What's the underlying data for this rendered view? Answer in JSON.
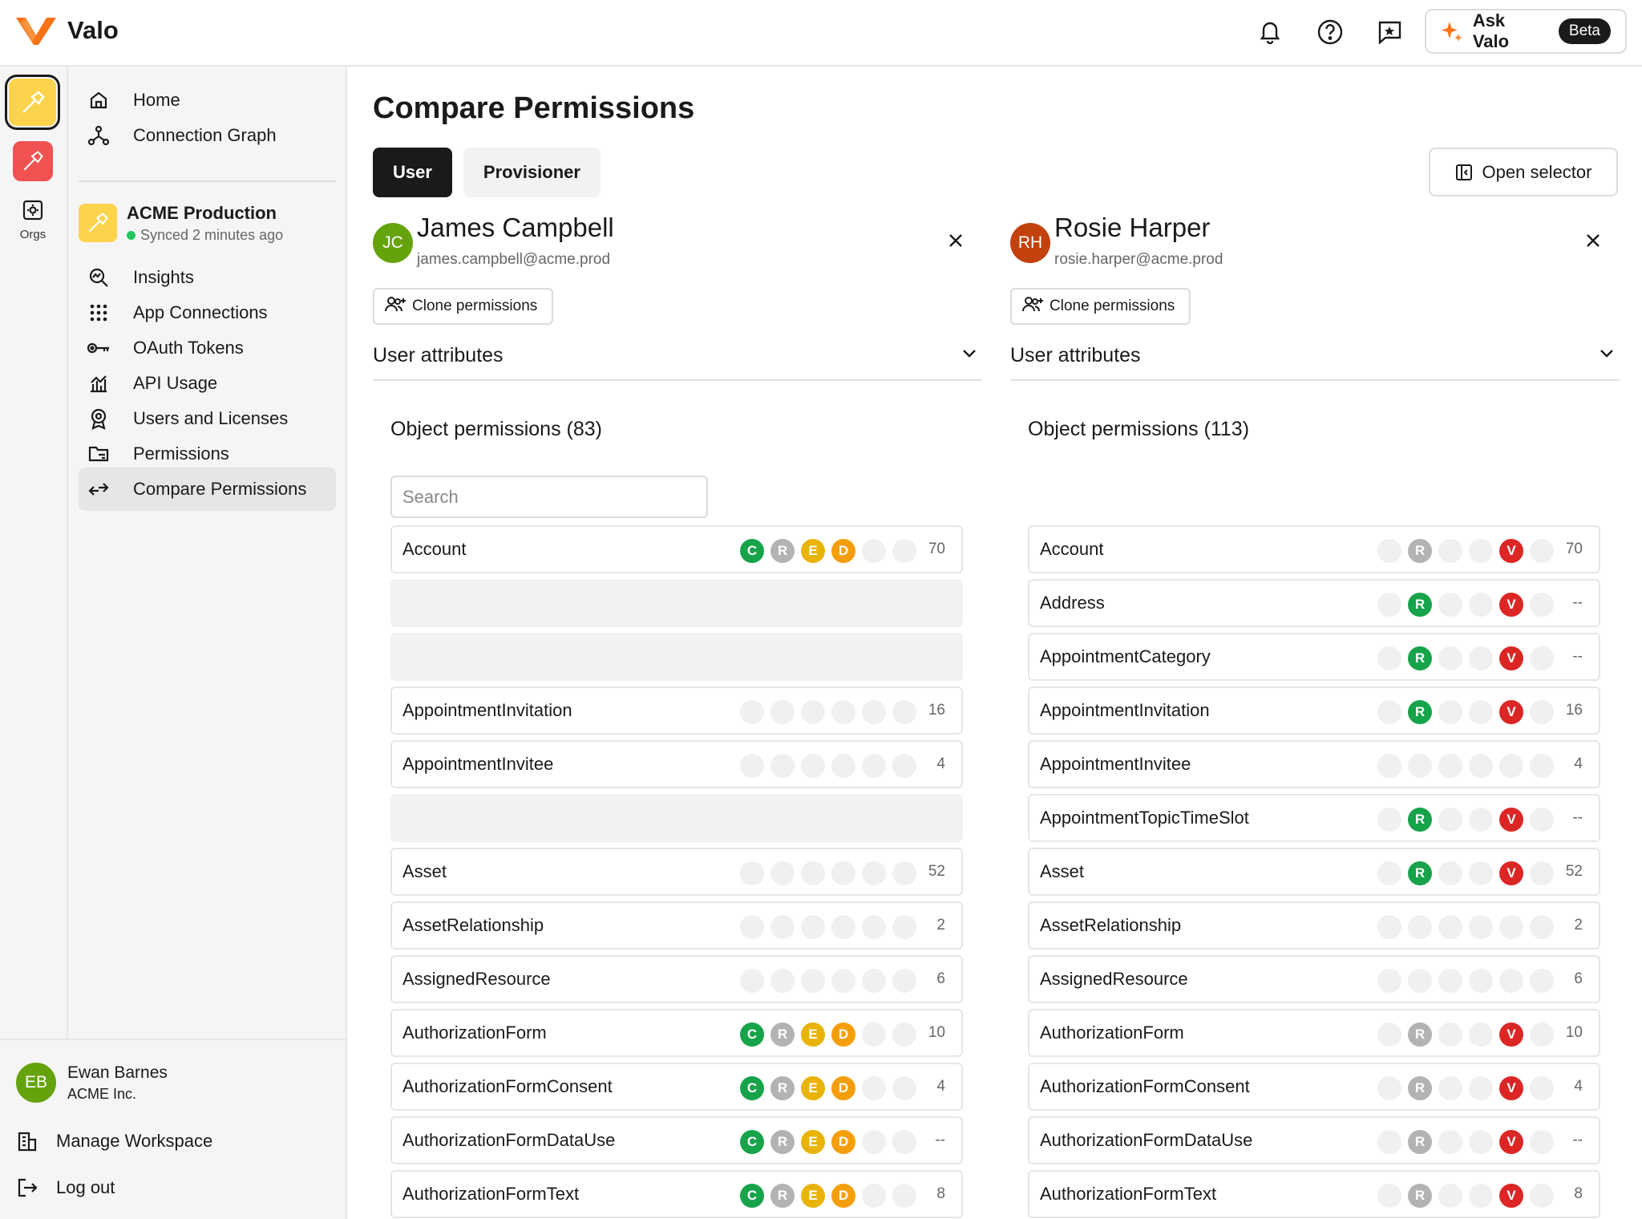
{
  "app": {
    "name": "Valo"
  },
  "header": {
    "ask_label": "Ask Valo",
    "beta": "Beta"
  },
  "rail": {
    "orgs_label": "Orgs"
  },
  "sidebar": {
    "nav_top": [
      {
        "label": "Home",
        "icon": "home-icon"
      },
      {
        "label": "Connection Graph",
        "icon": "graph-icon"
      }
    ],
    "org": {
      "name": "ACME Production",
      "sync": "Synced 2 minutes ago"
    },
    "nav_org": [
      {
        "label": "Insights",
        "icon": "insights-icon"
      },
      {
        "label": "App Connections",
        "icon": "grid-icon"
      },
      {
        "label": "OAuth Tokens",
        "icon": "key-icon"
      },
      {
        "label": "API Usage",
        "icon": "chart-icon"
      },
      {
        "label": "Users and Licenses",
        "icon": "badge-icon"
      },
      {
        "label": "Permissions",
        "icon": "folder-icon"
      },
      {
        "label": "Compare Permissions",
        "icon": "compare-icon",
        "active": true
      }
    ],
    "user": {
      "initials": "EB",
      "name": "Ewan Barnes",
      "org": "ACME Inc."
    },
    "manage_workspace": "Manage Workspace",
    "logout": "Log out"
  },
  "main": {
    "title": "Compare Permissions",
    "tabs": [
      "User",
      "Provisioner"
    ],
    "active_tab": "User",
    "open_selector": "Open selector"
  },
  "left": {
    "initials": "JC",
    "name": "James Campbell",
    "email": "james.campbell@acme.prod",
    "clone": "Clone permissions",
    "attributes": "User attributes",
    "obj_title": "Object permissions (83)",
    "search_placeholder": "Search",
    "rows": [
      {
        "name": "Account",
        "badges": [
          "C",
          "R",
          "E",
          "D",
          "",
          ""
        ],
        "count": "70"
      },
      {
        "skeleton": true
      },
      {
        "skeleton": true
      },
      {
        "name": "AppointmentInvitation",
        "badges": [
          "",
          "",
          "",
          "",
          "",
          ""
        ],
        "count": "16"
      },
      {
        "name": "AppointmentInvitee",
        "badges": [
          "",
          "",
          "",
          "",
          "",
          ""
        ],
        "count": "4"
      },
      {
        "skeleton": true
      },
      {
        "name": "Asset",
        "badges": [
          "",
          "",
          "",
          "",
          "",
          ""
        ],
        "count": "52"
      },
      {
        "name": "AssetRelationship",
        "badges": [
          "",
          "",
          "",
          "",
          "",
          ""
        ],
        "count": "2"
      },
      {
        "name": "AssignedResource",
        "badges": [
          "",
          "",
          "",
          "",
          "",
          ""
        ],
        "count": "6"
      },
      {
        "name": "AuthorizationForm",
        "badges": [
          "C",
          "R",
          "E",
          "D",
          "",
          ""
        ],
        "count": "10"
      },
      {
        "name": "AuthorizationFormConsent",
        "badges": [
          "C",
          "R",
          "E",
          "D",
          "",
          ""
        ],
        "count": "4"
      },
      {
        "name": "AuthorizationFormDataUse",
        "badges": [
          "C",
          "R",
          "E",
          "D",
          "",
          ""
        ],
        "count": "--"
      },
      {
        "name": "AuthorizationFormText",
        "badges": [
          "C",
          "R",
          "E",
          "D",
          "",
          ""
        ],
        "count": "8"
      }
    ]
  },
  "right": {
    "initials": "RH",
    "name": "Rosie Harper",
    "email": "rosie.harper@acme.prod",
    "clone": "Clone permissions",
    "attributes": "User attributes",
    "obj_title": "Object permissions (113)",
    "rows": [
      {
        "name": "Account",
        "badges": [
          "",
          "R",
          "",
          "",
          "V",
          ""
        ],
        "count": "70"
      },
      {
        "name": "Address",
        "badges": [
          "",
          "Rg",
          "",
          "",
          "V",
          ""
        ],
        "count": "--"
      },
      {
        "name": "AppointmentCategory",
        "badges": [
          "",
          "Rg",
          "",
          "",
          "V",
          ""
        ],
        "count": "--"
      },
      {
        "name": "AppointmentInvitation",
        "badges": [
          "",
          "Rg",
          "",
          "",
          "V",
          ""
        ],
        "count": "16"
      },
      {
        "name": "AppointmentInvitee",
        "badges": [
          "",
          "",
          "",
          "",
          "",
          ""
        ],
        "count": "4"
      },
      {
        "name": "AppointmentTopicTimeSlot",
        "badges": [
          "",
          "Rg",
          "",
          "",
          "V",
          ""
        ],
        "count": "--"
      },
      {
        "name": "Asset",
        "badges": [
          "",
          "Rg",
          "",
          "",
          "V",
          ""
        ],
        "count": "52"
      },
      {
        "name": "AssetRelationship",
        "badges": [
          "",
          "",
          "",
          "",
          "",
          ""
        ],
        "count": "2"
      },
      {
        "name": "AssignedResource",
        "badges": [
          "",
          "",
          "",
          "",
          "",
          ""
        ],
        "count": "6"
      },
      {
        "name": "AuthorizationForm",
        "badges": [
          "",
          "R",
          "",
          "",
          "V",
          ""
        ],
        "count": "10"
      },
      {
        "name": "AuthorizationFormConsent",
        "badges": [
          "",
          "R",
          "",
          "",
          "V",
          ""
        ],
        "count": "4"
      },
      {
        "name": "AuthorizationFormDataUse",
        "badges": [
          "",
          "R",
          "",
          "",
          "V",
          ""
        ],
        "count": "--"
      },
      {
        "name": "AuthorizationFormText",
        "badges": [
          "",
          "R",
          "",
          "",
          "V",
          ""
        ],
        "count": "8"
      }
    ]
  },
  "colors": {
    "accent": "#f97316",
    "org": "#fcd34d",
    "rail_red": "#f05252",
    "green": "#16a34a",
    "red": "#dc2626",
    "yellow": "#eab308"
  }
}
